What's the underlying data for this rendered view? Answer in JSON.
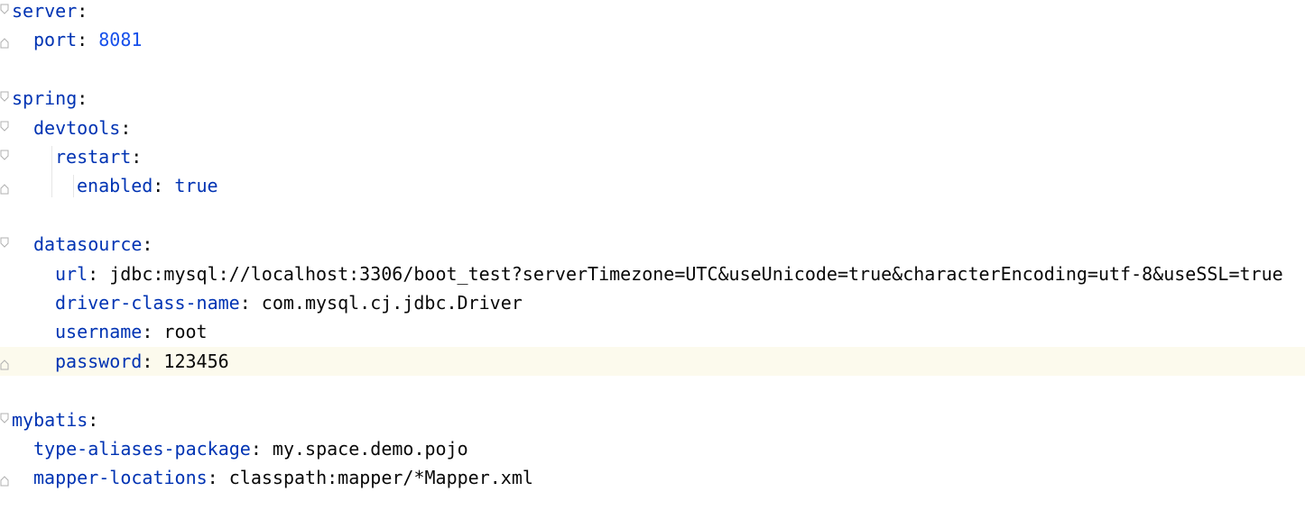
{
  "editor": {
    "language": "yaml",
    "current_line_index": 12,
    "current_line_color": "#fcfaed",
    "colors": {
      "key": "#0033b3",
      "number": "#1750eb",
      "keyword": "#0033b3",
      "plain": "#080808"
    },
    "lines": [
      {
        "indent": 0,
        "key": "server",
        "value": "",
        "vtype": "none",
        "fold": "start"
      },
      {
        "indent": 1,
        "key": "port",
        "value": "8081",
        "vtype": "num",
        "fold": "end"
      },
      {
        "indent": 0,
        "key": "",
        "value": "",
        "vtype": "none",
        "fold": "none"
      },
      {
        "indent": 0,
        "key": "spring",
        "value": "",
        "vtype": "none",
        "fold": "start"
      },
      {
        "indent": 1,
        "key": "devtools",
        "value": "",
        "vtype": "none",
        "fold": "start"
      },
      {
        "indent": 2,
        "key": "restart",
        "value": "",
        "vtype": "none",
        "fold": "start"
      },
      {
        "indent": 3,
        "key": "enabled",
        "value": "true",
        "vtype": "kw",
        "fold": "end"
      },
      {
        "indent": 0,
        "key": "",
        "value": "",
        "vtype": "none",
        "fold": "none"
      },
      {
        "indent": 1,
        "key": "datasource",
        "value": "",
        "vtype": "none",
        "fold": "start"
      },
      {
        "indent": 2,
        "key": "url",
        "value": "jdbc:mysql://localhost:3306/boot_test?serverTimezone=UTC&useUnicode=true&characterEncoding=utf-8&useSSL=true",
        "vtype": "str",
        "fold": "none"
      },
      {
        "indent": 2,
        "key": "driver-class-name",
        "value": "com.mysql.cj.jdbc.Driver",
        "vtype": "str",
        "fold": "none"
      },
      {
        "indent": 2,
        "key": "username",
        "value": "root",
        "vtype": "str",
        "fold": "none"
      },
      {
        "indent": 2,
        "key": "password",
        "value": "123456",
        "vtype": "str",
        "fold": "end"
      },
      {
        "indent": 0,
        "key": "",
        "value": "",
        "vtype": "none",
        "fold": "none"
      },
      {
        "indent": 0,
        "key": "mybatis",
        "value": "",
        "vtype": "none",
        "fold": "start"
      },
      {
        "indent": 1,
        "key": "type-aliases-package",
        "value": "my.space.demo.pojo",
        "vtype": "str",
        "fold": "none"
      },
      {
        "indent": 1,
        "key": "mapper-locations",
        "value": "classpath:mapper/*Mapper.xml",
        "vtype": "str",
        "fold": "end"
      }
    ]
  }
}
